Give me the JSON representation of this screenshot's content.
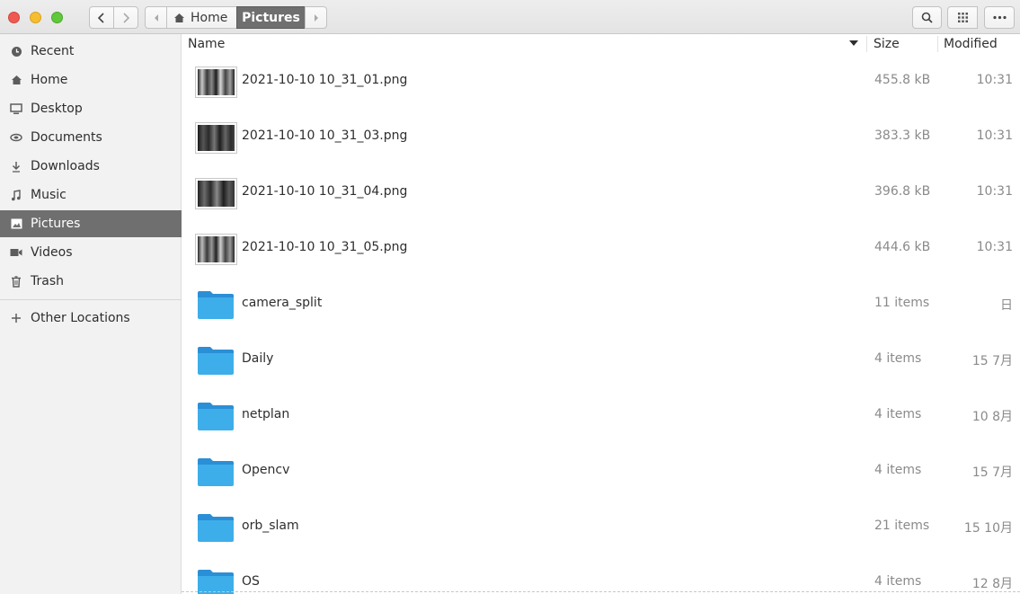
{
  "header": {
    "path_home": "Home",
    "path_current": "Pictures"
  },
  "sidebar": {
    "items": [
      {
        "label": "Recent",
        "icon": "clock-icon"
      },
      {
        "label": "Home",
        "icon": "home-icon"
      },
      {
        "label": "Desktop",
        "icon": "desktop-icon"
      },
      {
        "label": "Documents",
        "icon": "documents-icon"
      },
      {
        "label": "Downloads",
        "icon": "download-icon"
      },
      {
        "label": "Music",
        "icon": "music-icon"
      },
      {
        "label": "Pictures",
        "icon": "pictures-icon",
        "active": true
      },
      {
        "label": "Videos",
        "icon": "video-icon"
      },
      {
        "label": "Trash",
        "icon": "trash-icon"
      }
    ],
    "other_locations": "Other Locations"
  },
  "columns": {
    "name": "Name",
    "size": "Size",
    "modified": "Modified"
  },
  "files": [
    {
      "name": "2021-10-10 10_31_01.png",
      "size": "455.8 kB",
      "modified": "10:31",
      "type": "image"
    },
    {
      "name": "2021-10-10 10_31_03.png",
      "size": "383.3 kB",
      "modified": "10:31",
      "type": "image"
    },
    {
      "name": "2021-10-10 10_31_04.png",
      "size": "396.8 kB",
      "modified": "10:31",
      "type": "image"
    },
    {
      "name": "2021-10-10 10_31_05.png",
      "size": "444.6 kB",
      "modified": "10:31",
      "type": "image"
    },
    {
      "name": "camera_split",
      "size": "11 items",
      "modified": "日",
      "type": "folder"
    },
    {
      "name": "Daily",
      "size": "4 items",
      "modified": "15 7月",
      "type": "folder"
    },
    {
      "name": "netplan",
      "size": "4 items",
      "modified": "10 8月",
      "type": "folder"
    },
    {
      "name": "Opencv",
      "size": "4 items",
      "modified": "15 7月",
      "type": "folder"
    },
    {
      "name": "orb_slam",
      "size": "21 items",
      "modified": "15 10月",
      "type": "folder"
    },
    {
      "name": "OS",
      "size": "4 items",
      "modified": "12 8月",
      "type": "folder"
    }
  ],
  "colors": {
    "accent": "#6f6f6f",
    "folder": "#3daee9",
    "sidebar_bg": "#f2f2f2"
  }
}
